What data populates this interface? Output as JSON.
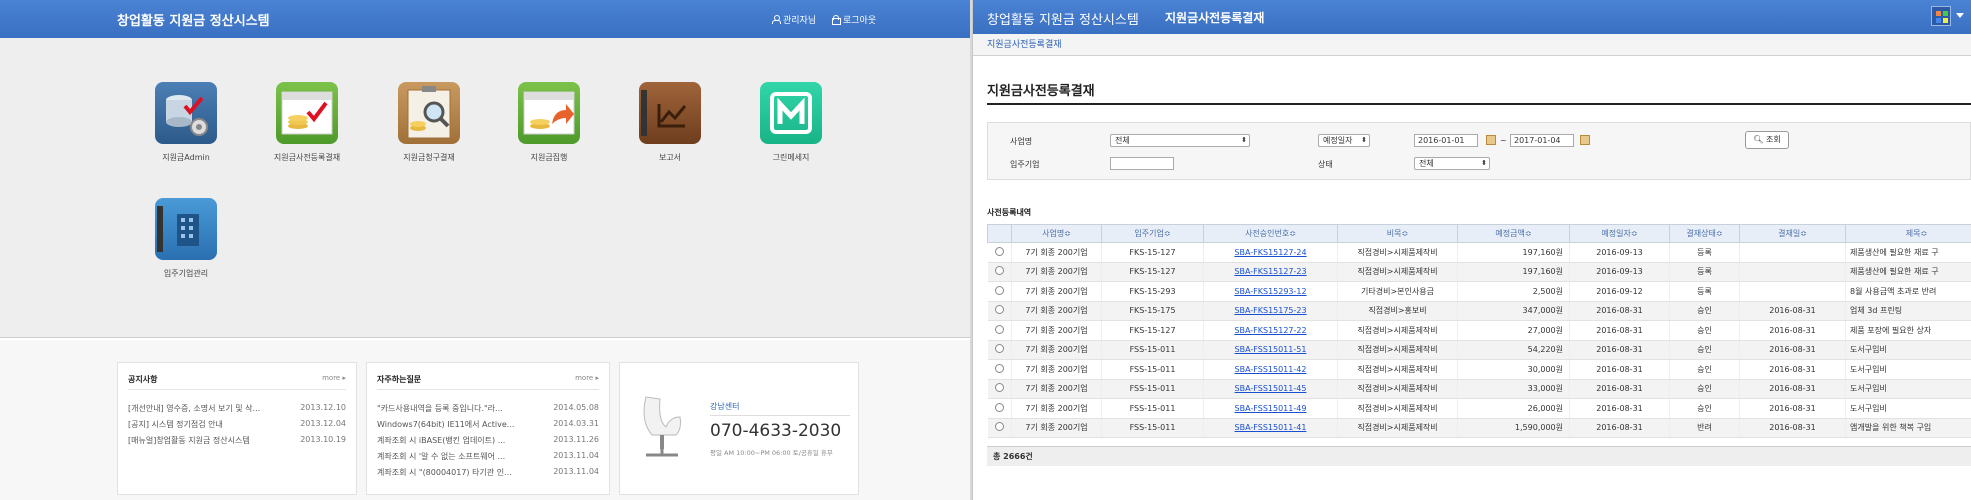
{
  "left": {
    "header": {
      "title": "창업활동 지원금 정산시스템",
      "manager_label": "관리자님",
      "logout_label": "로그아웃"
    },
    "tiles": [
      {
        "label": "지원금Admin",
        "icon": "database-gear-icon"
      },
      {
        "label": "지원금사전등록결재",
        "icon": "card-check-icon"
      },
      {
        "label": "지원금청구결재",
        "icon": "clipboard-search-icon"
      },
      {
        "label": "지원금집행",
        "icon": "card-arrow-icon"
      },
      {
        "label": "보고서",
        "icon": "report-book-icon"
      },
      {
        "label": "그린메세지",
        "icon": "message-m-icon"
      },
      {
        "label": "입주기업관리",
        "icon": "building-book-icon"
      }
    ],
    "notice": {
      "title": "공지사항",
      "more": "more",
      "items": [
        {
          "text": "[개선안내] 영수증, 소명서 보기 및 삭...",
          "date": "2013.12.10"
        },
        {
          "text": "[공지] 시스템 정기점검 안내",
          "date": "2013.12.04"
        },
        {
          "text": "[매뉴얼]창업활동 지원금 정산시스템",
          "date": "2013.10.19"
        }
      ]
    },
    "faq": {
      "title": "자주하는질문",
      "more": "more",
      "items": [
        {
          "text": "\"카드사용내역을 등록 중입니다.\"라...",
          "date": "2014.05.08"
        },
        {
          "text": "Windows7(64bit) IE11에서 Active...",
          "date": "2014.03.31"
        },
        {
          "text": "계좌조회 시 iBASE(뱅킨 업데이트) ...",
          "date": "2013.11.26"
        },
        {
          "text": "계좌조회 시 '알 수 없는 소프트웨어 ...",
          "date": "2013.11.04"
        },
        {
          "text": "계좌조회 시 \"(80004017) 타기관 인...",
          "date": "2013.11.04"
        }
      ]
    },
    "contact": {
      "center": "강남센터",
      "phone": "070-4633-2030",
      "hours": "평일 AM 10:00~PM 06:00 토/공휴일 휴무"
    }
  },
  "right": {
    "header": {
      "app_title": "창업활동 지원금 정산시스템",
      "page_name": "지원금사전등록결재"
    },
    "breadcrumb": "지원금사전등록결재",
    "page_title": "지원금사전등록결재",
    "filters": {
      "business_label": "사업명",
      "business_value": "전체",
      "date_type_value": "예정일자",
      "date_from": "2016-01-01",
      "date_sep": "~",
      "date_to": "2017-01-04",
      "search_label": "조회",
      "company_label": "입주기업",
      "company_value": "",
      "status_label": "상태",
      "status_value": "전체"
    },
    "section_title": "사전등록내역",
    "table": {
      "headers": [
        "",
        "사업명≎",
        "입주기업≎",
        "사전승인번호≎",
        "비목≎",
        "예정금액≎",
        "예정일자≎",
        "결재상태≎",
        "결재일≎",
        "제목≎"
      ],
      "rows": [
        [
          "7기 회종 200기업",
          "FKS-15-127",
          "SBA-FKS15127-24",
          "직접경비>시제품제작비",
          "197,160원",
          "2016-09-13",
          "등록",
          "",
          "제품생산에 필요한 재료 구"
        ],
        [
          "7기 회종 200기업",
          "FKS-15-127",
          "SBA-FKS15127-23",
          "직접경비>시제품제작비",
          "197,160원",
          "2016-09-13",
          "등록",
          "",
          "제품생산에 필요한 재료 구"
        ],
        [
          "7기 회종 200기업",
          "FKS-15-293",
          "SBA-FKS15293-12",
          "기타경비>본인사용금",
          "2,500원",
          "2016-09-12",
          "등록",
          "",
          "8월 사용금액 초과로 반려"
        ],
        [
          "7기 회종 200기업",
          "FKS-15-175",
          "SBA-FKS15175-23",
          "직접경비>홍보비",
          "347,000원",
          "2016-08-31",
          "승인",
          "2016-08-31",
          "업체 3d 프린팅"
        ],
        [
          "7기 회종 200기업",
          "FKS-15-127",
          "SBA-FKS15127-22",
          "직접경비>시제품제작비",
          "27,000원",
          "2016-08-31",
          "승인",
          "2016-08-31",
          "제품 포장에 필요한 상자"
        ],
        [
          "7기 회종 200기업",
          "FSS-15-011",
          "SBA-FSS15011-51",
          "직접경비>시제품제작비",
          "54,220원",
          "2016-08-31",
          "승인",
          "2016-08-31",
          "도서구입비"
        ],
        [
          "7기 회종 200기업",
          "FSS-15-011",
          "SBA-FSS15011-42",
          "직접경비>시제품제작비",
          "30,000원",
          "2016-08-31",
          "승인",
          "2016-08-31",
          "도서구입비"
        ],
        [
          "7기 회종 200기업",
          "FSS-15-011",
          "SBA-FSS15011-45",
          "직접경비>시제품제작비",
          "33,000원",
          "2016-08-31",
          "승인",
          "2016-08-31",
          "도서구입비"
        ],
        [
          "7기 회종 200기업",
          "FSS-15-011",
          "SBA-FSS15011-49",
          "직접경비>시제품제작비",
          "26,000원",
          "2016-08-31",
          "승인",
          "2016-08-31",
          "도서구입비"
        ],
        [
          "7기 회종 200기업",
          "FSS-15-011",
          "SBA-FSS15011-41",
          "직접경비>시제품제작비",
          "1,590,000원",
          "2016-08-31",
          "반려",
          "2016-08-31",
          "앱개발을 위한 책복 구입"
        ]
      ]
    },
    "total": "총 2666건"
  }
}
